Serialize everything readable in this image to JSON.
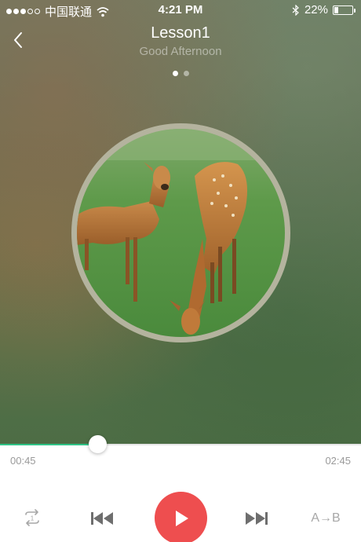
{
  "status_bar": {
    "carrier": "中国联通",
    "time": "4:21 PM",
    "battery": "22%",
    "battery_level": 0.22,
    "signal_bars": 3,
    "signal_total": 5
  },
  "header": {
    "title": "Lesson1",
    "subtitle": "Good Afternoon",
    "page_count": 2,
    "active_page": 0
  },
  "cover": {
    "description": "cover-art"
  },
  "progress": {
    "current": "00:45",
    "total": "02:45",
    "fraction": 0.27
  },
  "controls": {
    "repeat_badge": "1",
    "ab_label": "A→B"
  },
  "colors": {
    "accent": "#2fc487",
    "play": "#ee4e4f",
    "control_gray": "#a7a7a7",
    "time_gray": "#9a9a9a"
  },
  "icons": [
    "back-arrow-icon",
    "wifi-icon",
    "bluetooth-icon",
    "battery-icon",
    "repeat-one-icon",
    "skip-previous-icon",
    "play-icon",
    "skip-next-icon"
  ]
}
